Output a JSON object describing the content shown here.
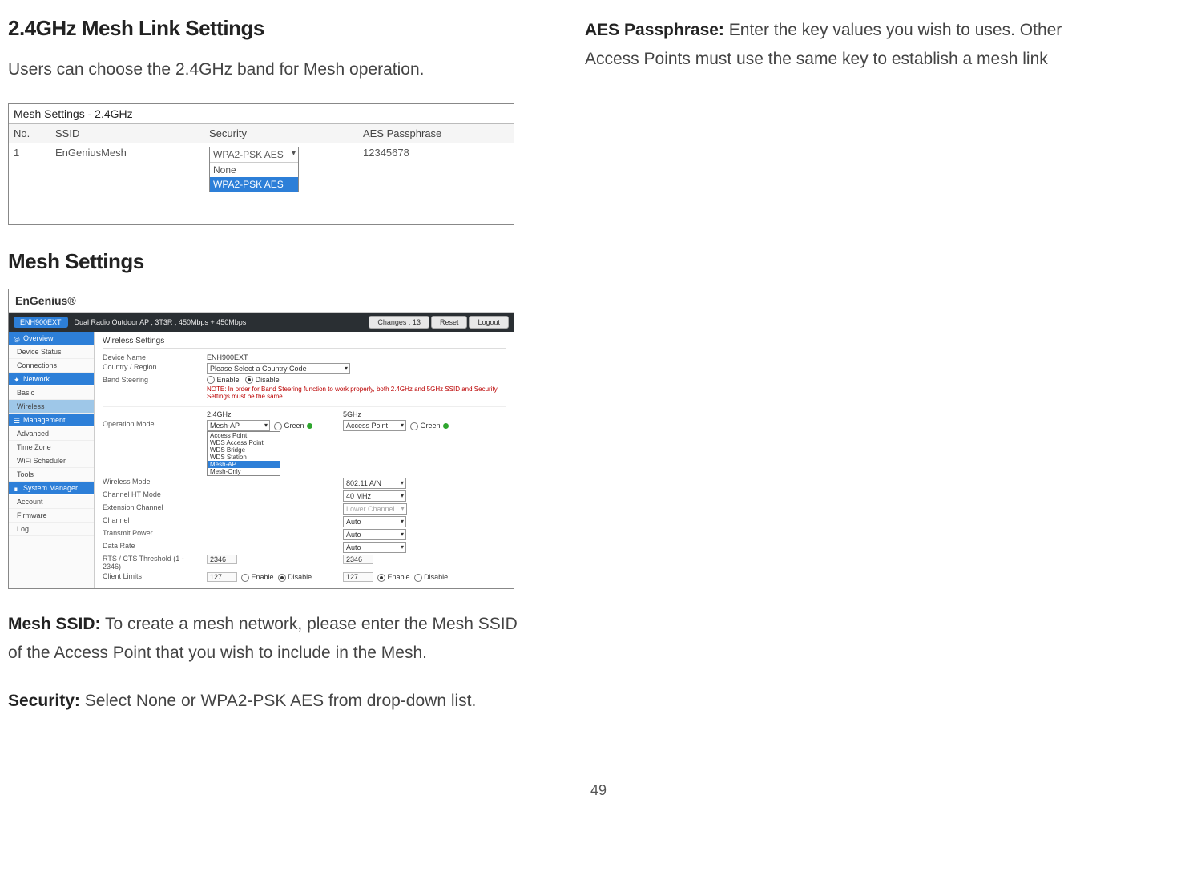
{
  "left": {
    "heading1": "2.4GHz Mesh Link Settings",
    "para1": "Users can choose the 2.4GHz band for Mesh operation.",
    "heading2": "Mesh Settings",
    "meshSsidLabel": "Mesh SSID:",
    "meshSsidText": " To create a mesh network, please enter the Mesh SSID of the Access Point that you wish to include in the Mesh.",
    "securityLabel": "Security:",
    "securityText": " Select None or WPA2-PSK AES from drop-down list."
  },
  "right": {
    "aesLabel": "AES Passphrase:",
    "aesText": " Enter the key values you wish to uses. Other Access Points must use the same key to establish a mesh link"
  },
  "shot1": {
    "title": "Mesh Settings - 2.4GHz",
    "headers": [
      "No.",
      "SSID",
      "Security",
      "AES Passphrase"
    ],
    "row": {
      "no": "1",
      "ssid": "EnGeniusMesh",
      "securitySelected": "WPA2-PSK AES",
      "securityOptions": [
        "None",
        "WPA2-PSK AES"
      ],
      "aes": "12345678"
    }
  },
  "shot2": {
    "brand": "EnGenius®",
    "model": "ENH900EXT",
    "desc": "Dual Radio Outdoor AP , 3T3R , 450Mbps + 450Mbps",
    "btnChanges": "Changes : 13",
    "btnReset": "Reset",
    "btnLogout": "Logout",
    "sidebar": {
      "overview": "Overview",
      "overviewItems": [
        "Device Status",
        "Connections"
      ],
      "network": "Network",
      "networkItems": [
        "Basic",
        "Wireless"
      ],
      "management": "Management",
      "managementItems": [
        "Advanced",
        "Time Zone",
        "WiFi Scheduler",
        "Tools"
      ],
      "system": "System Manager",
      "systemItems": [
        "Account",
        "Firmware",
        "Log"
      ]
    },
    "content": {
      "sectionTitle": "Wireless Settings",
      "deviceNameLbl": "Device Name",
      "deviceName": "ENH900EXT",
      "countryLbl": "Country / Region",
      "countryPlaceholder": "Please Select a Country Code",
      "bandSteerLbl": "Band Steering",
      "bandSteerEnable": "Enable",
      "bandSteerDisable": "Disable",
      "bandSteerNote": "NOTE:  In order for Band Steering function to work properly, both 2.4GHz and 5GHz SSID and Security Settings must be the same.",
      "colHeaders": {
        "g24": "2.4GHz",
        "g5": "5GHz"
      },
      "rows": {
        "opModeLbl": "Operation Mode",
        "opMode24List": [
          "Access Point",
          "WDS Access Point",
          "WDS Bridge",
          "WDS Station",
          "Mesh-AP",
          "Mesh-Only"
        ],
        "opMode24Selected": "Mesh-AP",
        "opMode5": "Access Point",
        "green": "Green",
        "wirelessModeLbl": "Wireless Mode",
        "wirelessMode5": "802.11 A/N",
        "chHtLbl": "Channel HT Mode",
        "chHt5": "40 MHz",
        "extChLbl": "Extension Channel",
        "extCh5": "Lower Channel",
        "channelLbl": "Channel",
        "channel5": "Auto",
        "txPowerLbl": "Transmit Power",
        "txPower5": "Auto",
        "dataRateLbl": "Data Rate",
        "dataRate5": "Auto",
        "rtsLbl": "RTS / CTS Threshold (1 - 2346)",
        "rts24": "2346",
        "rts5": "2346",
        "clientLimitsLbl": "Client Limits",
        "clientLimits24": "127",
        "clientLimits5": "127",
        "enable": "Enable",
        "disable": "Disable"
      }
    }
  },
  "pageNumber": "49"
}
